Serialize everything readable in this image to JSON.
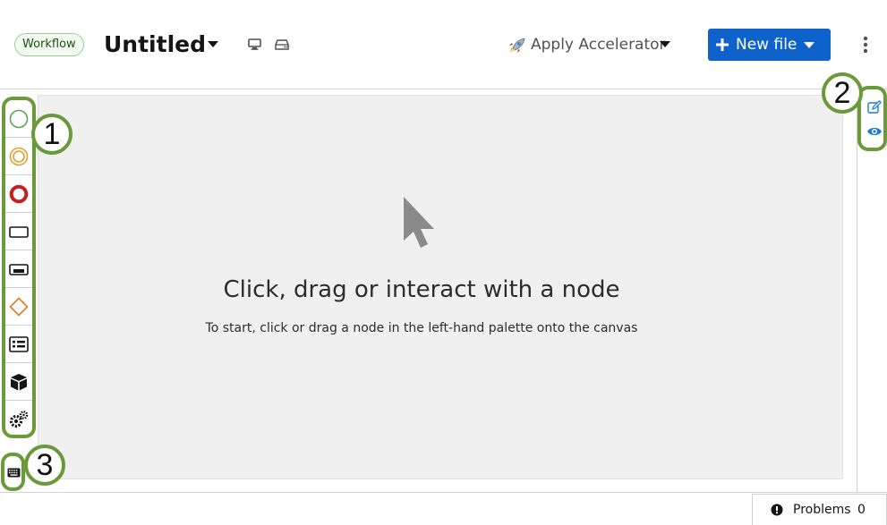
{
  "header": {
    "badge": "Workflow",
    "title": "Untitled",
    "view_icons": [
      "desktop-icon",
      "drive-icon"
    ],
    "accelerator": {
      "icon": "rocket-icon",
      "label": "Apply Accelerator"
    },
    "new_file": {
      "icon": "plus-icon",
      "label": "New file"
    },
    "more_icon": "kebab-icon"
  },
  "canvas": {
    "empty_icon": "mouse-pointer-icon",
    "empty_title": "Click, drag or interact with a node",
    "empty_subtitle": "To start, click or drag a node in the left-hand palette onto the canvas"
  },
  "palette": {
    "items": [
      {
        "name": "start-event-icon",
        "color": "#5aa454"
      },
      {
        "name": "intermediate-event-icon",
        "color": "#e0a030"
      },
      {
        "name": "end-event-icon",
        "color": "#c81e1e"
      },
      {
        "name": "task-icon",
        "color": "#151515"
      },
      {
        "name": "subprocess-icon",
        "color": "#151515"
      },
      {
        "name": "gateway-icon",
        "color": "#e07c1f"
      },
      {
        "name": "lane-icon",
        "color": "#151515"
      },
      {
        "name": "custom-task-icon",
        "color": "#151515"
      },
      {
        "name": "settings-gears-icon",
        "color": "#151515"
      }
    ]
  },
  "right_panel": {
    "icons": [
      "edit-icon",
      "eye-icon"
    ],
    "accent": "#1f7ad8"
  },
  "keyboard": {
    "icon": "keyboard-icon"
  },
  "callouts": [
    "1",
    "2",
    "3"
  ],
  "footer": {
    "problems_label": "Problems",
    "problems_count": "0"
  },
  "colors": {
    "primary": "#0f62cc",
    "highlight": "#6b9a3a",
    "canvas": "#f0f0f0"
  }
}
